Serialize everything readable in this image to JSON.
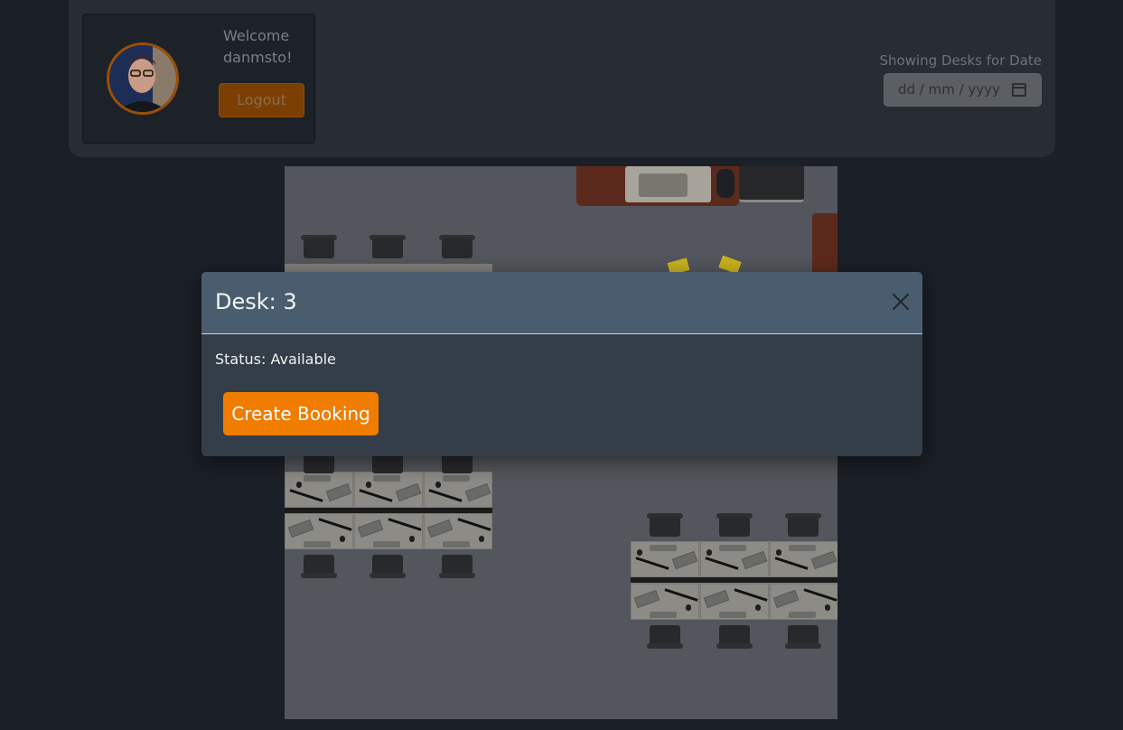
{
  "profile": {
    "welcome": "Welcome danmsto!",
    "logout_label": "Logout",
    "avatar_icon": "user-avatar-photo"
  },
  "date_filter": {
    "label": "Showing Desks for Date",
    "placeholder": "dd / mm / yyyy",
    "icon": "calendar-icon"
  },
  "modal": {
    "title": "Desk: 3",
    "status": "Status: Available",
    "create_label": "Create Booking",
    "close_icon": "close-icon"
  },
  "colors": {
    "accent": "#f07c00",
    "modal_header": "#4a5d6e",
    "modal_body": "#343e48",
    "page_bg": "#1b1f27"
  }
}
